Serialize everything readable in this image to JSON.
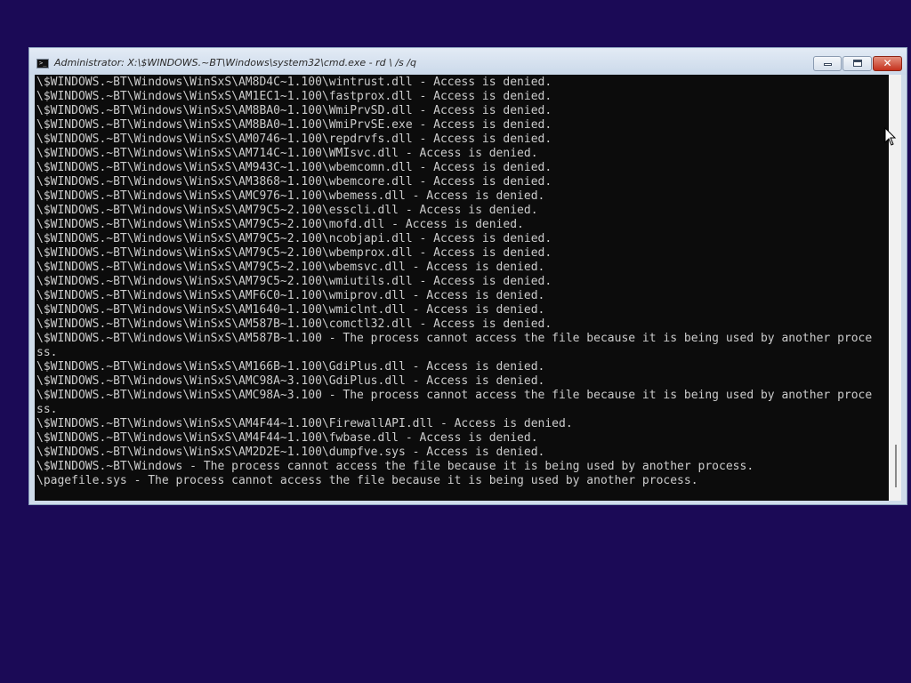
{
  "window": {
    "title": "Administrator: X:\\$WINDOWS.~BT\\Windows\\system32\\cmd.exe - rd \\ /s /q",
    "controls": {
      "minimize": "minimize",
      "maximize": "restore",
      "close": "✕"
    },
    "icon_prompt": ">_"
  },
  "console": {
    "lines": [
      "\\$WINDOWS.~BT\\Windows\\WinSxS\\AM8D4C~1.100\\wintrust.dll - Access is denied.",
      "\\$WINDOWS.~BT\\Windows\\WinSxS\\AM1EC1~1.100\\fastprox.dll - Access is denied.",
      "\\$WINDOWS.~BT\\Windows\\WinSxS\\AM8BA0~1.100\\WmiPrvSD.dll - Access is denied.",
      "\\$WINDOWS.~BT\\Windows\\WinSxS\\AM8BA0~1.100\\WmiPrvSE.exe - Access is denied.",
      "\\$WINDOWS.~BT\\Windows\\WinSxS\\AM0746~1.100\\repdrvfs.dll - Access is denied.",
      "\\$WINDOWS.~BT\\Windows\\WinSxS\\AM714C~1.100\\WMIsvc.dll - Access is denied.",
      "\\$WINDOWS.~BT\\Windows\\WinSxS\\AM943C~1.100\\wbemcomn.dll - Access is denied.",
      "\\$WINDOWS.~BT\\Windows\\WinSxS\\AM3868~1.100\\wbemcore.dll - Access is denied.",
      "\\$WINDOWS.~BT\\Windows\\WinSxS\\AMC976~1.100\\wbemess.dll - Access is denied.",
      "\\$WINDOWS.~BT\\Windows\\WinSxS\\AM79C5~2.100\\esscli.dll - Access is denied.",
      "\\$WINDOWS.~BT\\Windows\\WinSxS\\AM79C5~2.100\\mofd.dll - Access is denied.",
      "\\$WINDOWS.~BT\\Windows\\WinSxS\\AM79C5~2.100\\ncobjapi.dll - Access is denied.",
      "\\$WINDOWS.~BT\\Windows\\WinSxS\\AM79C5~2.100\\wbemprox.dll - Access is denied.",
      "\\$WINDOWS.~BT\\Windows\\WinSxS\\AM79C5~2.100\\wbemsvc.dll - Access is denied.",
      "\\$WINDOWS.~BT\\Windows\\WinSxS\\AM79C5~2.100\\wmiutils.dll - Access is denied.",
      "\\$WINDOWS.~BT\\Windows\\WinSxS\\AMF6C0~1.100\\wmiprov.dll - Access is denied.",
      "\\$WINDOWS.~BT\\Windows\\WinSxS\\AM1640~1.100\\wmiclnt.dll - Access is denied.",
      "\\$WINDOWS.~BT\\Windows\\WinSxS\\AM587B~1.100\\comctl32.dll - Access is denied.",
      "\\$WINDOWS.~BT\\Windows\\WinSxS\\AM587B~1.100 - The process cannot access the file because it is being used by another proce",
      "ss.",
      "\\$WINDOWS.~BT\\Windows\\WinSxS\\AM166B~1.100\\GdiPlus.dll - Access is denied.",
      "\\$WINDOWS.~BT\\Windows\\WinSxS\\AMC98A~3.100\\GdiPlus.dll - Access is denied.",
      "\\$WINDOWS.~BT\\Windows\\WinSxS\\AMC98A~3.100 - The process cannot access the file because it is being used by another proce",
      "ss.",
      "\\$WINDOWS.~BT\\Windows\\WinSxS\\AM4F44~1.100\\FirewallAPI.dll - Access is denied.",
      "\\$WINDOWS.~BT\\Windows\\WinSxS\\AM4F44~1.100\\fwbase.dll - Access is denied.",
      "\\$WINDOWS.~BT\\Windows\\WinSxS\\AM2D2E~1.100\\dumpfve.sys - Access is denied.",
      "\\$WINDOWS.~BT\\Windows - The process cannot access the file because it is being used by another process.",
      "\\pagefile.sys - The process cannot access the file because it is being used by another process."
    ]
  },
  "scrollbar": {
    "position_fraction": 1.0
  },
  "colors": {
    "desktop": "#1b0a56",
    "console_bg": "#0c0c0c",
    "console_fg": "#cccccc",
    "close_button": "#c5311d"
  }
}
